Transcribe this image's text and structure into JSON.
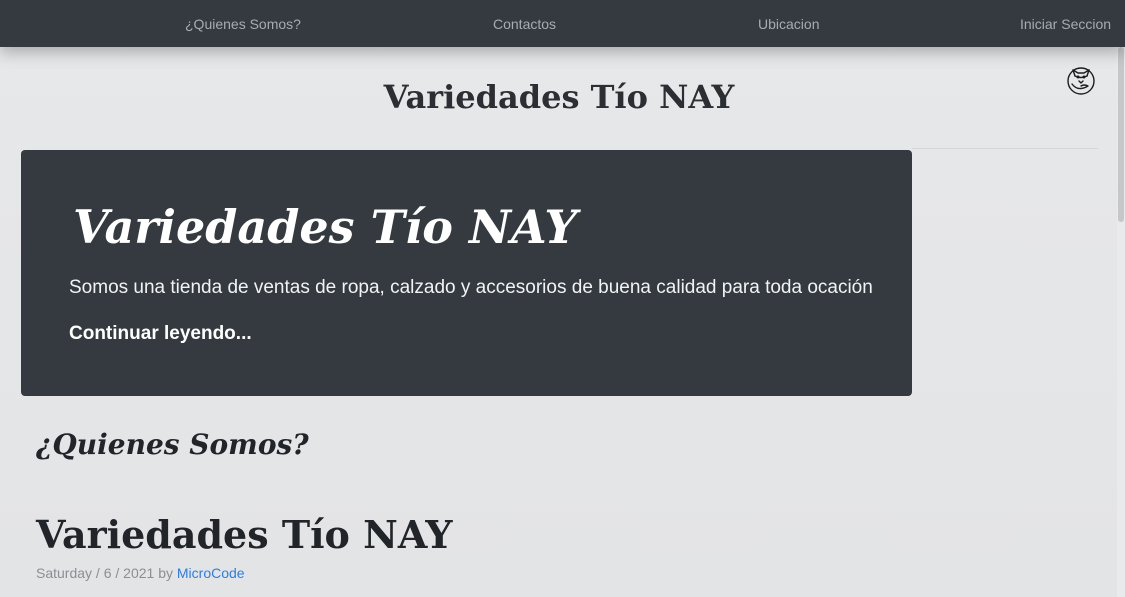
{
  "nav": {
    "items": [
      {
        "label": "¿Quienes Somos?"
      },
      {
        "label": "Contactos"
      },
      {
        "label": "Ubicacion"
      },
      {
        "label": "Iniciar Seccion"
      }
    ]
  },
  "header": {
    "title": "Variedades Tío NAY",
    "logo_icon": "fox-logo-icon"
  },
  "jumbotron": {
    "title": "Variedades Tío NAY",
    "lead": "Somos una tienda de ventas de ropa, calzado y accesorios de buena calidad para toda ocación",
    "link_label": "Continuar leyendo..."
  },
  "section": {
    "heading": "¿Quienes Somos?"
  },
  "post": {
    "title": "Variedades Tío NAY",
    "date": "Saturday / 6 / 2021",
    "by": "by",
    "author": "MicroCode"
  },
  "colors": {
    "navbar": "#343a40",
    "jumbotron": "#343a40",
    "link": "#2f7de1"
  }
}
